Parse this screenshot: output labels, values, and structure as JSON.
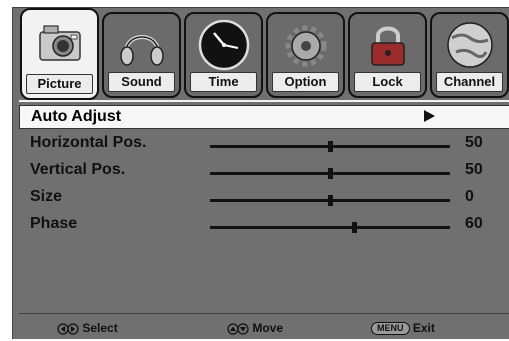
{
  "tabs": [
    {
      "label": "Picture",
      "icon": "camera-icon",
      "active": true
    },
    {
      "label": "Sound",
      "icon": "headphones-icon",
      "active": false
    },
    {
      "label": "Time",
      "icon": "clock-icon",
      "active": false
    },
    {
      "label": "Option",
      "icon": "gear-icon",
      "active": false
    },
    {
      "label": "Lock",
      "icon": "lock-icon",
      "active": false
    },
    {
      "label": "Channel",
      "icon": "globe-icon",
      "active": false
    }
  ],
  "menu": {
    "auto_adjust": {
      "label": "Auto Adjust"
    },
    "horizontal_pos": {
      "label": "Horizontal Pos.",
      "value": "50",
      "level": 0.5
    },
    "vertical_pos": {
      "label": "Vertical Pos.",
      "value": "50",
      "level": 0.5
    },
    "size": {
      "label": "Size",
      "value": "0",
      "level": 0.5
    },
    "phase": {
      "label": "Phase",
      "value": "60",
      "level": 0.6
    }
  },
  "footer": {
    "select_label": "Select",
    "move_label": "Move",
    "menu_key": "MENU",
    "exit_label": "Exit"
  },
  "colors": {
    "panel": "#707070",
    "tab_active": "#f2f2f2",
    "selection": "#f7f7f7"
  }
}
